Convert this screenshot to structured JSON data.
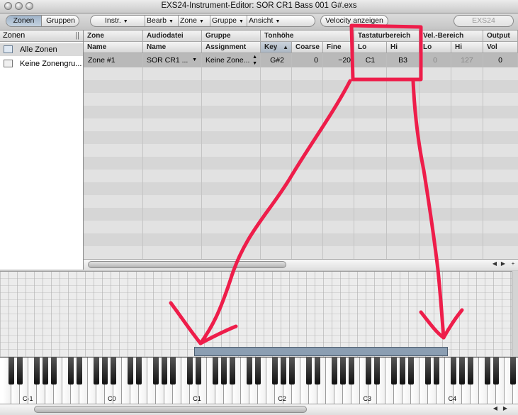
{
  "window": {
    "title": "EXS24-Instrument-Editor: SOR CR1 Bass 001 G#.exs"
  },
  "toolbar": {
    "view_toggle": [
      "Zonen",
      "Gruppen"
    ],
    "view_selected": "Zonen",
    "menus": [
      "Instr.",
      "Bearb",
      "Zone",
      "Gruppe",
      "Ansicht"
    ],
    "velocity_button": "Velocity anzeigen",
    "exs24_button": "EXS24"
  },
  "sidebar": {
    "header": "Zonen",
    "items": [
      {
        "label": "Alle Zonen",
        "icon": "zones-folder-icon",
        "selected": true
      },
      {
        "label": "Keine Zonengru...",
        "icon": "zone-group-icon",
        "selected": false
      }
    ]
  },
  "table": {
    "group_headers": [
      "Zone",
      "Audiodatei",
      "Gruppe",
      "Tonhöhe",
      "Tastaturbereich",
      "Vel.-Bereich",
      "Output"
    ],
    "sub_headers": [
      "Name",
      "Name",
      "Assignment",
      "Key",
      "Coarse",
      "Fine",
      "Lo",
      "Hi",
      "Lo",
      "Hi",
      "Vol"
    ],
    "rows": [
      {
        "zone_name": "Zone #1",
        "audio_file": "SOR CR1 ...",
        "group": "Keine Zone...",
        "key": "G#2",
        "coarse": "0",
        "fine": "−20",
        "key_lo": "C1",
        "key_hi": "B3",
        "vel_lo": "0",
        "vel_hi": "127",
        "vol": "0"
      }
    ]
  },
  "keyboard": {
    "labels": [
      "C-1",
      "C0",
      "C1",
      "C2",
      "C3",
      "C4"
    ],
    "zone_range": {
      "lo": "C1",
      "hi": "B3"
    }
  },
  "colors": {
    "annotation": "#ee1d4a",
    "zone_bar": "#8b9eb2",
    "selected_row": "#b9b9b9"
  }
}
